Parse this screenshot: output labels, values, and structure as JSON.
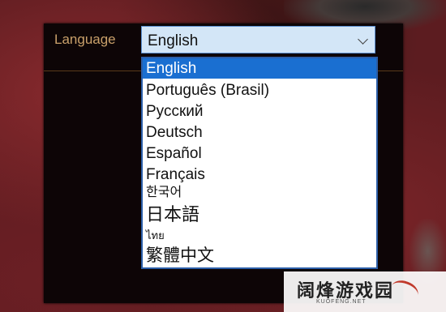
{
  "settings": {
    "language_label": "Language",
    "selected_value": "English"
  },
  "language_options": [
    "English",
    "Português (Brasil)",
    "Русский",
    "Deutsch",
    "Español",
    "Français",
    "한국어",
    "日本語",
    "ไทย",
    "繁體中文"
  ],
  "watermark": {
    "text": "阔烽游戏园",
    "subtext": "KUOFENG.NET"
  },
  "colors": {
    "label": "#c9a06a",
    "highlight": "#1a6fd1",
    "select_bg": "#d3e6f7"
  }
}
